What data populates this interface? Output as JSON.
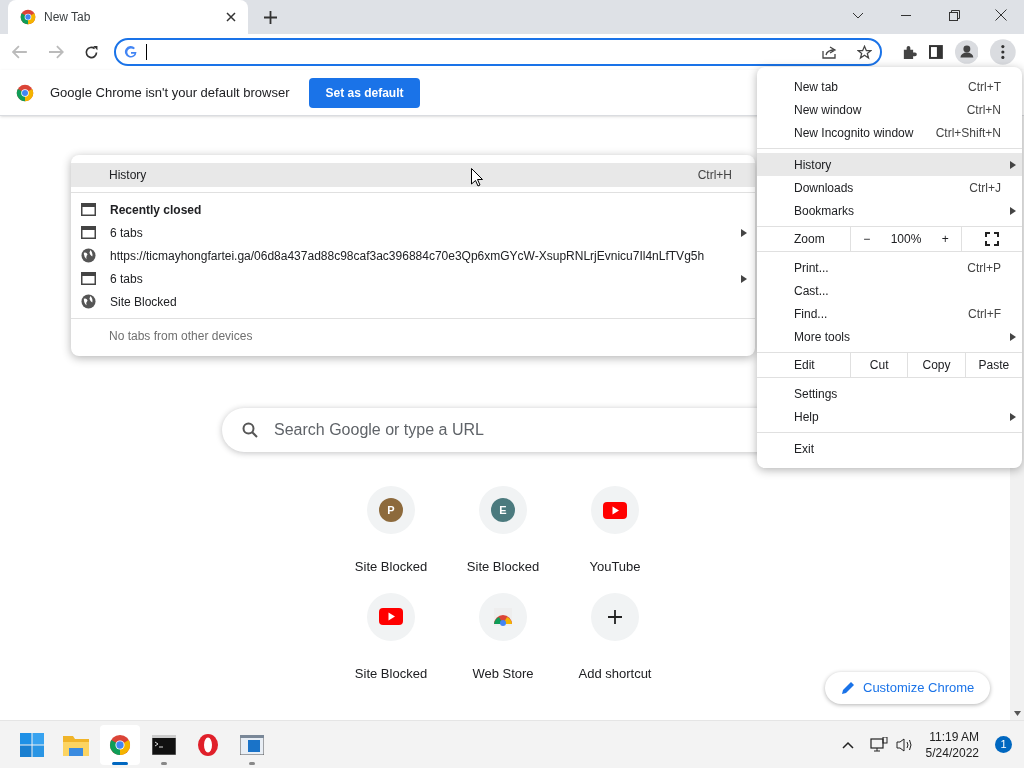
{
  "tabs": [
    {
      "title": "New Tab",
      "selected": true
    }
  ],
  "infobar": {
    "message": "Google Chrome isn't your default browser",
    "button": "Set as default"
  },
  "history_submenu": {
    "header": {
      "label": "History",
      "shortcut": "Ctrl+H",
      "highlighted": true
    },
    "section_title": "Recently closed",
    "items": [
      {
        "kind": "window",
        "label": "6 tabs",
        "has_submenu": true
      },
      {
        "kind": "page",
        "label": "https://ticmayhongfartei.ga/06d8a437ad88c98caf3ac396884c70e3Qp6xmGYcW-XsupRNLrjEvnicu7Il4nLfTVg5h",
        "has_submenu": false
      },
      {
        "kind": "window",
        "label": "6 tabs",
        "has_submenu": true
      },
      {
        "kind": "page",
        "label": "Site Blocked",
        "has_submenu": false
      }
    ],
    "footer": "No tabs from other devices"
  },
  "main_menu": [
    {
      "kind": "item",
      "label": "New tab",
      "shortcut": "Ctrl+T",
      "has_submenu": false,
      "highlighted": false
    },
    {
      "kind": "item",
      "label": "New window",
      "shortcut": "Ctrl+N",
      "has_submenu": false,
      "highlighted": false
    },
    {
      "kind": "item",
      "label": "New Incognito window",
      "shortcut": "Ctrl+Shift+N",
      "has_submenu": false,
      "highlighted": false
    },
    {
      "kind": "separator"
    },
    {
      "kind": "item",
      "label": "History",
      "has_submenu": true,
      "highlighted": true
    },
    {
      "kind": "item",
      "label": "Downloads",
      "shortcut": "Ctrl+J",
      "has_submenu": false,
      "highlighted": false
    },
    {
      "kind": "item",
      "label": "Bookmarks",
      "has_submenu": true,
      "highlighted": false
    },
    {
      "kind": "zoom",
      "label": "Zoom",
      "minus": "−",
      "value": "100%",
      "plus": "+"
    },
    {
      "kind": "item",
      "label": "Print...",
      "shortcut": "Ctrl+P",
      "has_submenu": false,
      "highlighted": false
    },
    {
      "kind": "item",
      "label": "Cast...",
      "has_submenu": false,
      "highlighted": false
    },
    {
      "kind": "item",
      "label": "Find...",
      "shortcut": "Ctrl+F",
      "has_submenu": false,
      "highlighted": false
    },
    {
      "kind": "item",
      "label": "More tools",
      "has_submenu": true,
      "highlighted": false
    },
    {
      "kind": "edit",
      "label": "Edit",
      "buttons": [
        "Cut",
        "Copy",
        "Paste"
      ]
    },
    {
      "kind": "item",
      "label": "Settings",
      "has_submenu": false,
      "highlighted": false
    },
    {
      "kind": "item",
      "label": "Help",
      "has_submenu": true,
      "highlighted": false
    },
    {
      "kind": "separator"
    },
    {
      "kind": "item",
      "label": "Exit",
      "has_submenu": false,
      "highlighted": false
    }
  ],
  "search": {
    "placeholder": "Search Google or type a URL"
  },
  "shortcuts": [
    {
      "kind": "letter",
      "letter": "P",
      "color": "#8d6a3c",
      "label": "Site Blocked"
    },
    {
      "kind": "letter",
      "letter": "E",
      "color": "#4b7a7e",
      "label": "Site Blocked"
    },
    {
      "kind": "youtube",
      "label": "YouTube"
    },
    {
      "kind": "youtube",
      "label": "Site Blocked"
    },
    {
      "kind": "webstore",
      "label": "Web Store"
    },
    {
      "kind": "add",
      "label": "Add shortcut"
    }
  ],
  "customize": {
    "label": "Customize Chrome"
  },
  "taskbar": {
    "apps": [
      {
        "kind": "start",
        "active": false,
        "running": false
      },
      {
        "kind": "folder",
        "active": false,
        "running": false
      },
      {
        "kind": "chrome",
        "active": true,
        "running": true
      },
      {
        "kind": "terminal",
        "active": false,
        "running": true
      },
      {
        "kind": "opera",
        "active": false,
        "running": false
      },
      {
        "kind": "window",
        "active": false,
        "running": true
      }
    ],
    "time": "11:19 AM",
    "date": "5/24/2022",
    "notifications": "1"
  }
}
